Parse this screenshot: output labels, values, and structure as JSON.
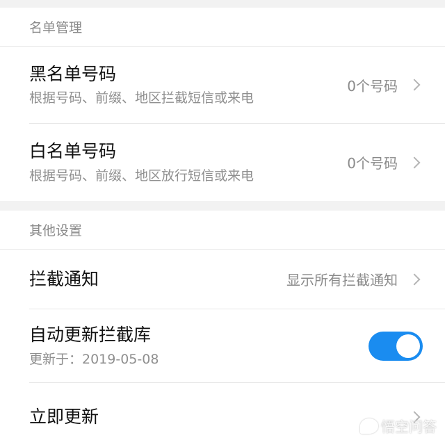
{
  "list_management": {
    "header": "名单管理",
    "blacklist": {
      "title": "黑名单号码",
      "subtitle": "根据号码、前缀、地区拦截短信或来电",
      "value": "0个号码"
    },
    "whitelist": {
      "title": "白名单号码",
      "subtitle": "根据号码、前缀、地区放行短信或来电",
      "value": "0个号码"
    }
  },
  "other_settings": {
    "header": "其他设置",
    "block_notification": {
      "title": "拦截通知",
      "value": "显示所有拦截通知"
    },
    "auto_update": {
      "title": "自动更新拦截库",
      "subtitle": "更新于：2019-05-08",
      "enabled": true
    },
    "update_now": {
      "title": "立即更新"
    }
  },
  "watermark": {
    "text": "悟空问答"
  },
  "colors": {
    "accent": "#1a8cf0",
    "background": "#f2f2f2"
  }
}
